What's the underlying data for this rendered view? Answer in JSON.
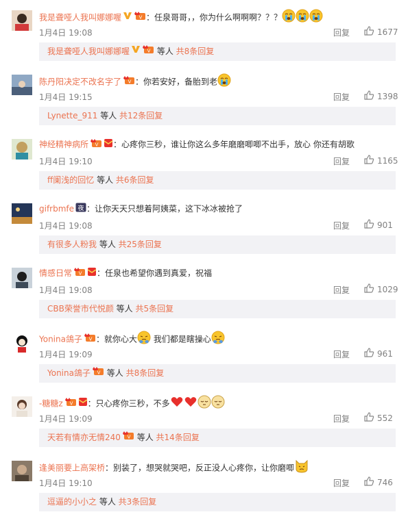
{
  "comments": [
    {
      "user": "我是聋哑人我叫娜娜喔",
      "badges": [
        "v",
        "vip"
      ],
      "text": "：任泉哥哥，，你为什么啊啊啊？？？",
      "emoji": [
        "cry",
        "cry",
        "cry"
      ],
      "time": "1月4日 19:08",
      "reply": "回复",
      "likes": "1677",
      "sub_name": "我是聋哑人我叫娜娜喔",
      "sub_badges": [
        "v",
        "vip"
      ],
      "sub_mid": " 等人 ",
      "sub_count": "共8条回复"
    },
    {
      "user": "陈丹阳决定不改名字了",
      "badges": [
        "vip"
      ],
      "text": "：你若安好，备胎到老",
      "emoji": [
        "cry"
      ],
      "time": "1月4日 19:15",
      "reply": "回复",
      "likes": "1398",
      "sub_name": "Lynette_911",
      "sub_badges": [],
      "sub_mid": " 等人 ",
      "sub_count": "共12条回复"
    },
    {
      "user": "神经精神病所",
      "badges": [
        "vip",
        "red"
      ],
      "text": "：心疼你三秒，谁让你这么多年磨磨唧唧不出手，放心 你还有胡歌",
      "emoji": [],
      "time": "1月4日 19:10",
      "reply": "回复",
      "likes": "1165",
      "sub_name": "ff阑浅的回忆",
      "sub_badges": [],
      "sub_mid": " 等人 ",
      "sub_count": "共6条回复"
    },
    {
      "user": "gifrbmfe",
      "badges": [
        "night"
      ],
      "text": "：让你天天只想着阿姨菜，这下冰冰被抢了",
      "emoji": [],
      "time": "1月4日 19:08",
      "reply": "回复",
      "likes": "901",
      "sub_name": "有很多人粉我",
      "sub_badges": [],
      "sub_mid": " 等人 ",
      "sub_count": "共25条回复"
    },
    {
      "user": "情感日常",
      "badges": [
        "vip",
        "red"
      ],
      "text": "：任泉也希望你遇到真爱，祝福",
      "emoji": [],
      "time": "1月4日 19:08",
      "reply": "回复",
      "likes": "1029",
      "sub_name": "CBB荣誉市代悦颜",
      "sub_badges": [],
      "sub_mid": " 等人 ",
      "sub_count": "共5条回复"
    },
    {
      "user": "Yonina鴿子",
      "badges": [
        "vip"
      ],
      "text": "：就你心大",
      "emoji": [
        "shy"
      ],
      "text2": " 我们都是瞎操心",
      "emoji2": [
        "shy"
      ],
      "time": "1月4日 19:09",
      "reply": "回复",
      "likes": "961",
      "sub_name": "Yonina鴿子",
      "sub_badges": [
        "vip"
      ],
      "sub_mid": " 等人 ",
      "sub_count": "共8条回复"
    },
    {
      "user": "-糖糖z",
      "badges": [
        "vip",
        "red"
      ],
      "text": "：只心疼你三秒，不多",
      "emoji": [
        "heart",
        "heart",
        "calm",
        "calm"
      ],
      "time": "1月4日 19:09",
      "reply": "回复",
      "likes": "552",
      "sub_name": "天若有情亦无情240",
      "sub_badges": [
        "vip"
      ],
      "sub_mid": " 等人 ",
      "sub_count": "共14条回复"
    },
    {
      "user": "逢美丽要上高架桥",
      "badges": [],
      "text": "：别装了，想哭就哭吧，反正没人心疼你，让你磨唧",
      "emoji": [
        "cat"
      ],
      "time": "1月4日 19:10",
      "reply": "回复",
      "likes": "746",
      "sub_name": "逗逼的小小之",
      "sub_badges": [],
      "sub_mid": " 等人 ",
      "sub_count": "共3条回复"
    }
  ],
  "icons": {
    "like": "thumbs-up-icon",
    "verified": "verified-v-icon",
    "vip": "vip-crown-icon",
    "red": "red-envelope-icon",
    "night": "night-badge-icon"
  },
  "colors": {
    "name": "#eb7350",
    "text": "#333333",
    "meta": "#808080",
    "sub_bg": "#f2f2f5"
  }
}
